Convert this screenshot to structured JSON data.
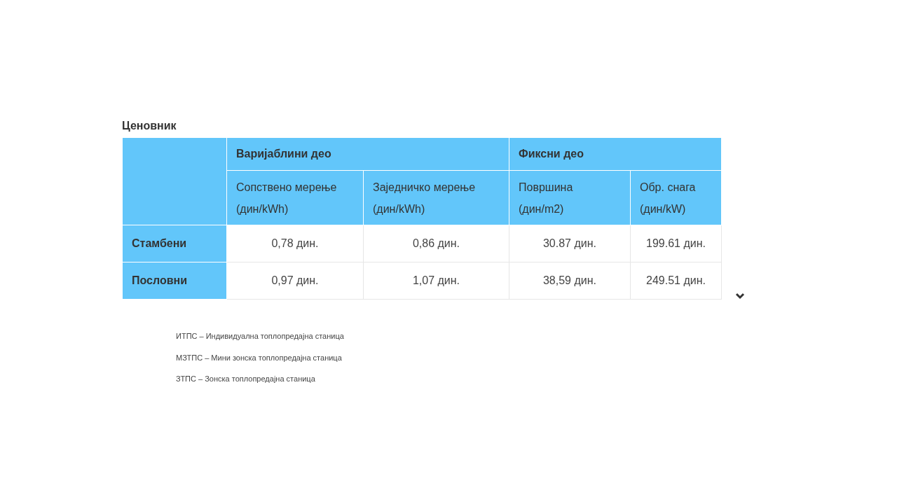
{
  "title": "Ценовник",
  "table": {
    "group_headers": [
      "Варијаблини део",
      "Фиксни део"
    ],
    "columns": [
      "Сопствено мерење (дин/kWh)",
      "Заједничко мерење (дин/kWh)",
      "Површина (дин/m2)",
      "Обр. снага (дин/kW)"
    ],
    "rows": [
      {
        "label": "Стамбени",
        "cells": [
          "0,78 дин.",
          "0,86 дин.",
          "30.87 дин.",
          "199.61 дин."
        ]
      },
      {
        "label": "Пословни",
        "cells": [
          "0,97 дин.",
          "1,07 дин.",
          "38,59 дин.",
          "249.51 дин."
        ]
      }
    ]
  },
  "notes": [
    "ИТПС – Индивидуална топлопредајна станица",
    "МЗТПС – Мини зонска топлопредајна станица",
    "ЗТПС – Зонска топлопредајна станица"
  ]
}
